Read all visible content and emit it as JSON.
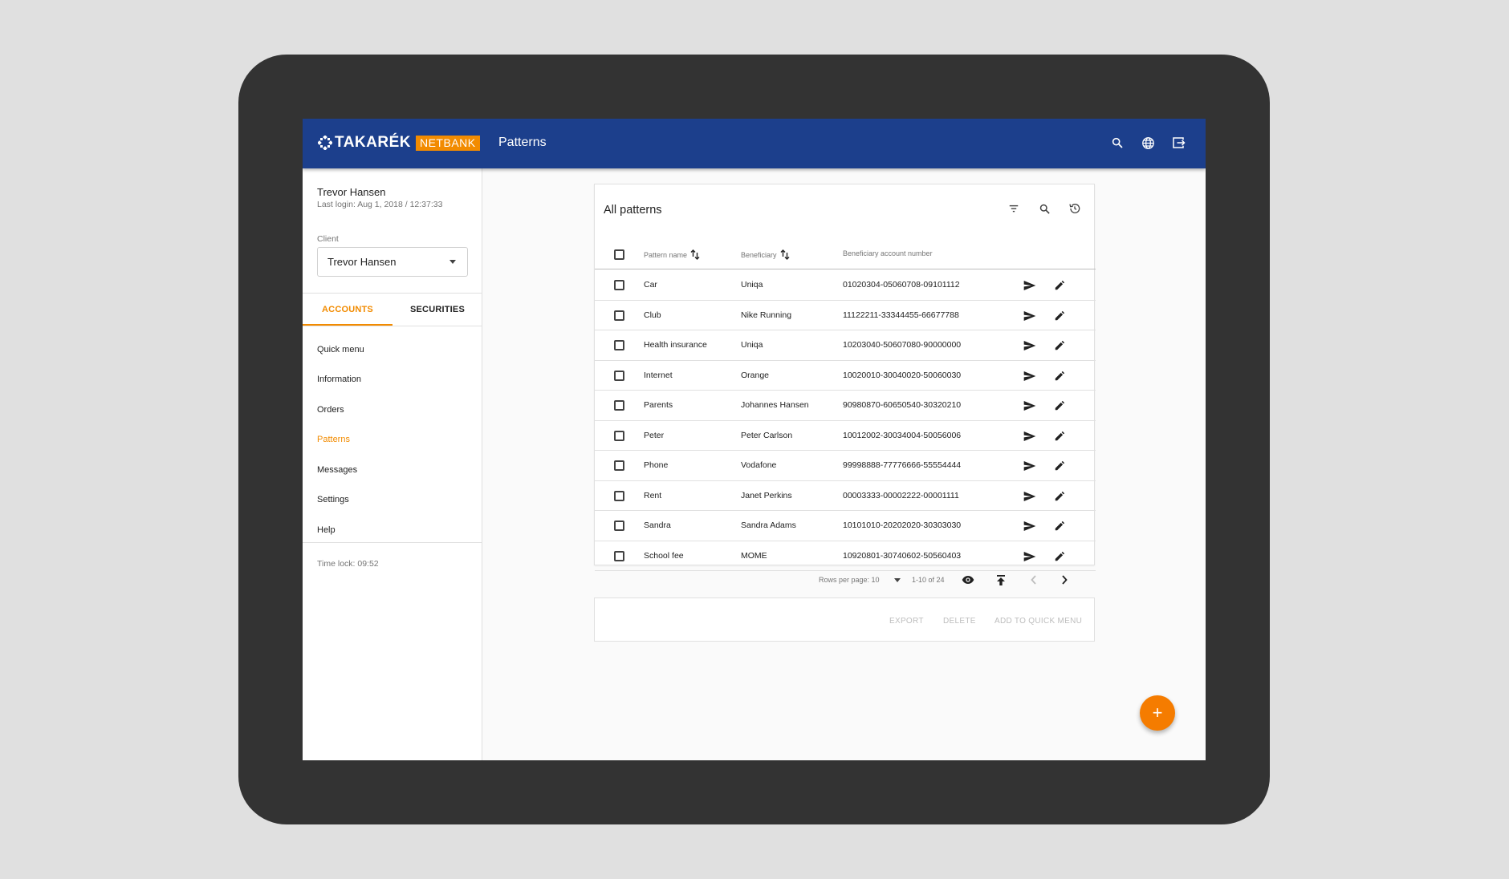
{
  "brand": {
    "name": "TAKARÉK",
    "badge": "NETBANK",
    "accent": "#f28b00",
    "bar_color": "#1c3f8c"
  },
  "appbar": {
    "title": "Patterns",
    "icons": [
      "search-icon",
      "globe-icon",
      "logout-icon"
    ]
  },
  "sidebar": {
    "user_name": "Trevor Hansen",
    "last_login": "Last login: Aug 1, 2018 / 12:37:33",
    "client_label": "Client",
    "client_value": "Trevor Hansen",
    "tabs": [
      {
        "label": "ACCOUNTS",
        "active": true
      },
      {
        "label": "SECURITIES",
        "active": false
      }
    ],
    "nav": [
      {
        "label": "Quick menu"
      },
      {
        "label": "Information"
      },
      {
        "label": "Orders"
      },
      {
        "label": "Patterns",
        "active": true
      },
      {
        "label": "Messages"
      },
      {
        "label": "Settings"
      },
      {
        "label": "Help"
      }
    ],
    "time_lock": "Time lock: 09:52"
  },
  "card": {
    "title": "All patterns",
    "tools": [
      "filter-icon",
      "search-icon",
      "history-icon"
    ],
    "columns": {
      "name": "Pattern name",
      "beneficiary": "Beneficiary",
      "account": "Beneficiary account number"
    },
    "rows": [
      {
        "name": "Car",
        "beneficiary": "Uniqa",
        "account": "01020304-05060708-09101112"
      },
      {
        "name": "Club",
        "beneficiary": "Nike Running",
        "account": "11122211-33344455-66677788"
      },
      {
        "name": "Health insurance",
        "beneficiary": "Uniqa",
        "account": "10203040-50607080-90000000"
      },
      {
        "name": "Internet",
        "beneficiary": "Orange",
        "account": "10020010-30040020-50060030"
      },
      {
        "name": "Parents",
        "beneficiary": "Johannes Hansen",
        "account": "90980870-60650540-30320210"
      },
      {
        "name": "Peter",
        "beneficiary": "Peter Carlson",
        "account": "10012002-30034004-50056006"
      },
      {
        "name": "Phone",
        "beneficiary": "Vodafone",
        "account": "99998888-77776666-55554444"
      },
      {
        "name": "Rent",
        "beneficiary": "Janet Perkins",
        "account": "00003333-00002222-00001111"
      },
      {
        "name": "Sandra",
        "beneficiary": "Sandra Adams",
        "account": "10101010-20202020-30303030"
      },
      {
        "name": "School fee",
        "beneficiary": "MOME",
        "account": "10920801-30740602-50560403"
      }
    ],
    "pager": {
      "rows_per_page": "Rows per page: 10",
      "range": "1-10 of 24"
    }
  },
  "bulk_actions": {
    "export": "EXPORT",
    "delete": "DELETE",
    "add_quick": "ADD TO QUICK MENU"
  },
  "fab": {
    "label": "+"
  }
}
